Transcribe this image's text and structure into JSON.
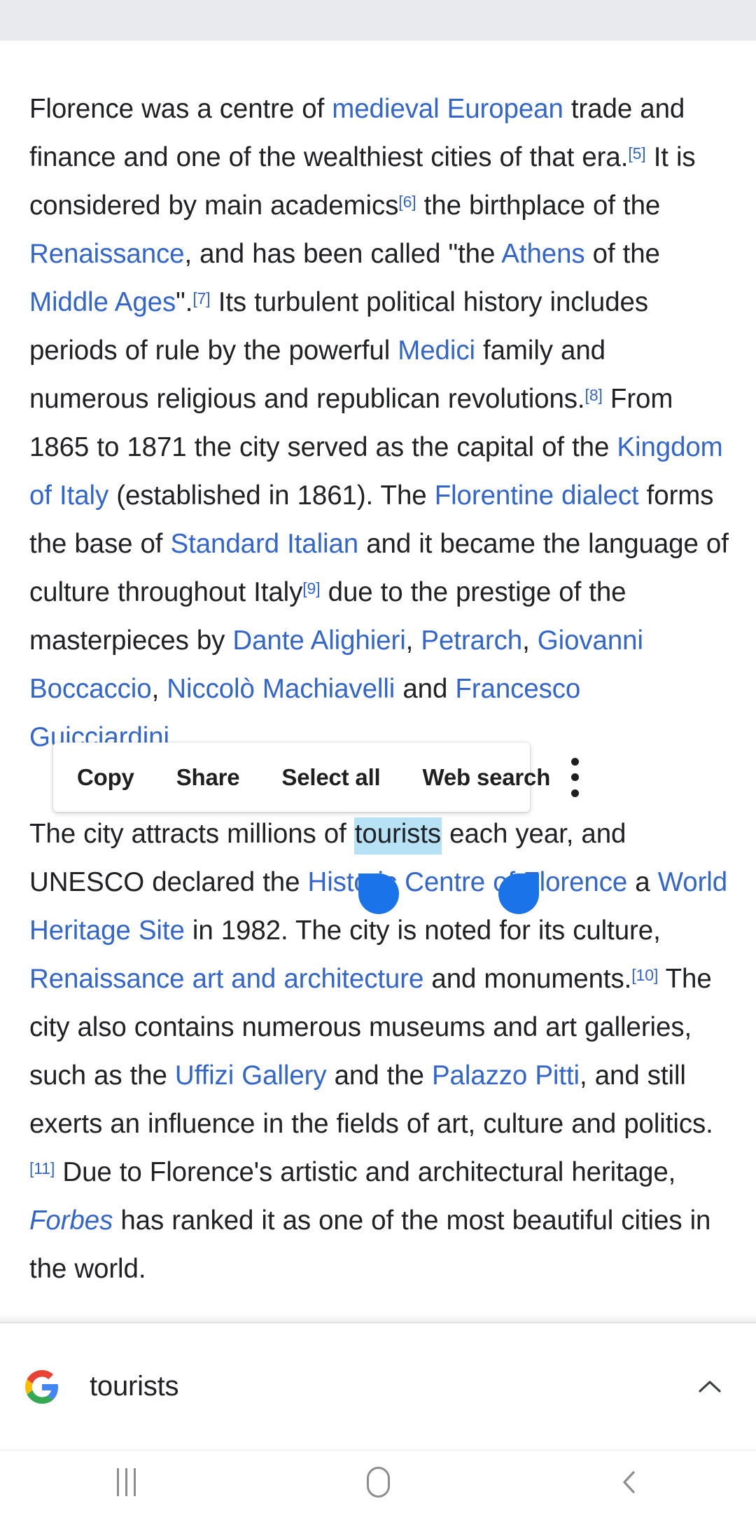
{
  "app": {
    "platform": "android",
    "page_title": "Florence"
  },
  "colors": {
    "link": "#3366cc",
    "text": "#202124",
    "selection_highlight": "#b7e1f5",
    "selection_handle": "#1a73e8",
    "status_strip": "#e9eaed",
    "nav_icon": "#8d8d8d"
  },
  "article": {
    "paragraph1": {
      "segments": [
        {
          "text": "Florence was a centre of ",
          "type": "text"
        },
        {
          "text": "medieval European",
          "type": "link"
        },
        {
          "text": " trade and finance and one of the wealthiest cities of that era.",
          "type": "text"
        },
        {
          "text": "[5]",
          "type": "ref"
        },
        {
          "text": " It is considered by main academics",
          "type": "text"
        },
        {
          "text": "[6]",
          "type": "ref"
        },
        {
          "text": " the birthplace of the ",
          "type": "text"
        },
        {
          "text": "Renaissance",
          "type": "link"
        },
        {
          "text": ", and has been called \"the ",
          "type": "text"
        },
        {
          "text": "Athens",
          "type": "link"
        },
        {
          "text": " of the ",
          "type": "text"
        },
        {
          "text": "Middle Ages",
          "type": "link"
        },
        {
          "text": "\".",
          "type": "text"
        },
        {
          "text": "[7]",
          "type": "ref"
        },
        {
          "text": " Its turbulent political history includes periods of rule by the powerful ",
          "type": "text"
        },
        {
          "text": "Medici",
          "type": "link"
        },
        {
          "text": " family and numerous religious and republican revolutions.",
          "type": "text"
        },
        {
          "text": "[8]",
          "type": "ref"
        },
        {
          "text": " From 1865 to 1871 the city served as the capital of the ",
          "type": "text"
        },
        {
          "text": "Kingdom of Italy",
          "type": "link"
        },
        {
          "text": " (established in 1861). The ",
          "type": "text"
        },
        {
          "text": "Florentine dialect",
          "type": "link"
        },
        {
          "text": " forms the base of ",
          "type": "text"
        },
        {
          "text": "Standard Italian",
          "type": "link"
        },
        {
          "text": " and it became the language of culture throughout Italy",
          "type": "text"
        },
        {
          "text": "[9]",
          "type": "ref"
        },
        {
          "text": " due to the prestige of the masterpieces by ",
          "type": "text"
        },
        {
          "text": "Dante Alighieri",
          "type": "link"
        },
        {
          "text": ", ",
          "type": "text"
        },
        {
          "text": "Petrarch",
          "type": "link"
        },
        {
          "text": ", ",
          "type": "text"
        },
        {
          "text": "Giovanni Boccaccio",
          "type": "link"
        },
        {
          "text": ", ",
          "type": "text"
        },
        {
          "text": "Niccolò Machiavelli",
          "type": "link"
        },
        {
          "text": " and ",
          "type": "text"
        },
        {
          "text": "Francesco Guicciardini",
          "type": "link"
        },
        {
          "text": ".",
          "type": "text"
        }
      ]
    },
    "paragraph2": {
      "segments": [
        {
          "text": "The city attracts millions of ",
          "type": "text"
        },
        {
          "text": "tourists",
          "type": "selected"
        },
        {
          "text": " each year, and UNESCO declared the ",
          "type": "text"
        },
        {
          "text": "Historic Centre of Florence",
          "type": "link"
        },
        {
          "text": " a ",
          "type": "text"
        },
        {
          "text": "World Heritage Site",
          "type": "link"
        },
        {
          "text": " in 1982. The city is noted for its culture, ",
          "type": "text"
        },
        {
          "text": "Renaissance art and architecture",
          "type": "link"
        },
        {
          "text": " and monuments.",
          "type": "text"
        },
        {
          "text": "[10]",
          "type": "ref"
        },
        {
          "text": " The city also contains numerous museums and art galleries, such as the ",
          "type": "text"
        },
        {
          "text": "Uffizi Gallery",
          "type": "link"
        },
        {
          "text": " and the ",
          "type": "text"
        },
        {
          "text": "Palazzo Pitti",
          "type": "link"
        },
        {
          "text": ", and still exerts an influence in the fields of art, culture and politics.",
          "type": "text"
        },
        {
          "text": "[11]",
          "type": "ref"
        },
        {
          "text": " Due to Florence's artistic and architectural heritage, ",
          "type": "text"
        },
        {
          "text": "Forbes",
          "type": "link-italic"
        },
        {
          "text": " has ranked it as one of the most beautiful cities in the world.",
          "type": "text"
        }
      ]
    }
  },
  "selection": {
    "selected_text": "tourists",
    "left_handle_name": "selection-handle-left",
    "right_handle_name": "selection-handle-right"
  },
  "context_menu": {
    "items": [
      {
        "label": "Copy",
        "name": "copy"
      },
      {
        "label": "Share",
        "name": "share"
      },
      {
        "label": "Select all",
        "name": "select-all"
      },
      {
        "label": "Web search",
        "name": "web-search"
      }
    ],
    "overflow_icon": "more-vertical-icon"
  },
  "google_bar": {
    "logo_icon": "google-g-icon",
    "query": "tourists",
    "expand_icon": "chevron-up-icon"
  },
  "nav_bar": {
    "recents": {
      "label": "Recents",
      "icon": "recents-icon"
    },
    "home": {
      "label": "Home",
      "icon": "home-icon"
    },
    "back": {
      "label": "Back",
      "icon": "back-chevron-icon"
    }
  }
}
